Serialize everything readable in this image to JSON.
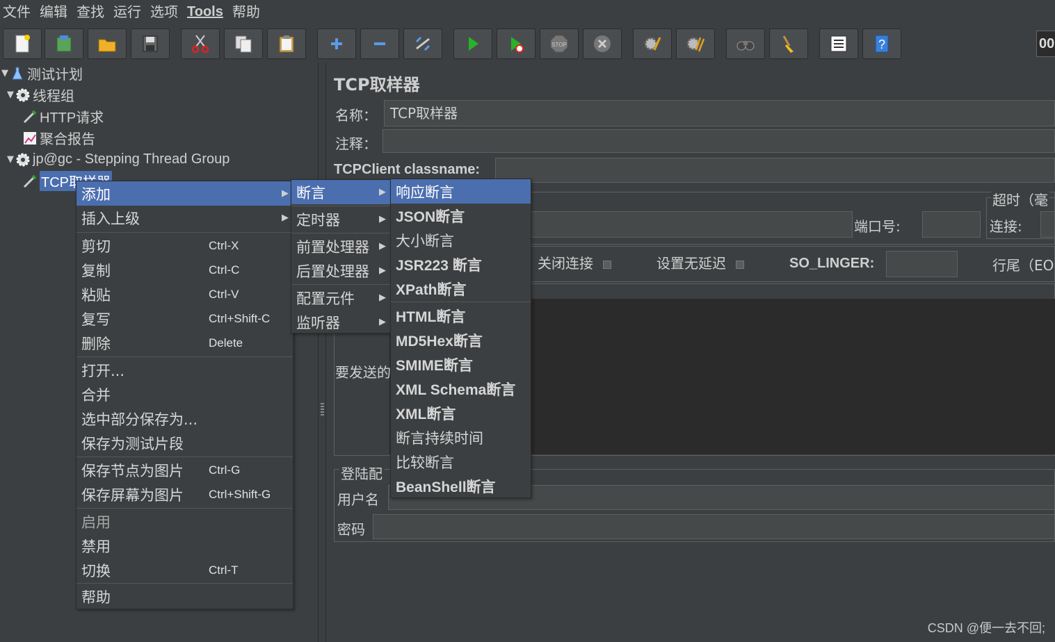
{
  "menubar": [
    "文件",
    "编辑",
    "查找",
    "运行",
    "选项",
    "Tools",
    "帮助"
  ],
  "toolbar": {
    "buttons": [
      "new-icon",
      "templates-icon",
      "open-icon",
      "save-icon",
      "cut-icon",
      "copy-icon",
      "paste-icon",
      "expand-icon",
      "collapse-icon",
      "toggle-icon",
      "start-icon",
      "start-no-pause-icon",
      "stop-icon",
      "shutdown-icon",
      "clear-icon",
      "clear-all-icon",
      "search-icon",
      "reset-search-icon",
      "function-helper-icon",
      "help-icon"
    ],
    "counter": "00"
  },
  "tree": {
    "nodes": [
      {
        "label": "测试计划"
      },
      {
        "label": "线程组"
      },
      {
        "label": "HTTP请求"
      },
      {
        "label": "聚合报告"
      },
      {
        "label": "jp@gc - Stepping Thread Group"
      },
      {
        "label": "TCP取样器"
      }
    ]
  },
  "panel": {
    "title": "TCP取样器",
    "name_label": "名称：",
    "name_value": "TCP取样器",
    "comment_label": "注释：",
    "classname_label": "TCPClient classname:",
    "timeout_label": "超时（毫",
    "port_label": "端口号:",
    "connect_label": "连接:",
    "close_conn_label": "关闭连接",
    "nodelay_label": "设置无延迟",
    "so_linger_label": "SO_LINGER:",
    "eol_label": "行尾（EO",
    "send_label": "要发送的",
    "login_group_label": "登陆配",
    "username_label": "用户名",
    "password_label": "密码"
  },
  "context_menu": {
    "items": [
      {
        "label": "添加",
        "submenu": true
      },
      {
        "label": "插入上级",
        "submenu": true
      },
      {
        "label": "剪切",
        "shortcut": "Ctrl-X"
      },
      {
        "label": "复制",
        "shortcut": "Ctrl-C"
      },
      {
        "label": "粘贴",
        "shortcut": "Ctrl-V"
      },
      {
        "label": "复写",
        "shortcut": "Ctrl+Shift-C"
      },
      {
        "label": "删除",
        "shortcut": "Delete"
      },
      {
        "label": "打开..."
      },
      {
        "label": "合并"
      },
      {
        "label": "选中部分保存为..."
      },
      {
        "label": "保存为测试片段"
      },
      {
        "label": "保存节点为图片",
        "shortcut": "Ctrl-G"
      },
      {
        "label": "保存屏幕为图片",
        "shortcut": "Ctrl+Shift-G"
      },
      {
        "label": "启用"
      },
      {
        "label": "禁用"
      },
      {
        "label": "切换",
        "shortcut": "Ctrl-T"
      },
      {
        "label": "帮助"
      }
    ]
  },
  "add_submenu": {
    "items": [
      "断言",
      "定时器",
      "前置处理器",
      "后置处理器",
      "配置元件",
      "监听器"
    ]
  },
  "assert_submenu": {
    "items": [
      "响应断言",
      "JSON断言",
      "大小断言",
      "JSR223 断言",
      "XPath断言",
      "HTML断言",
      "MD5Hex断言",
      "SMIME断言",
      "XML Schema断言",
      "XML断言",
      "断言持续时间",
      "比较断言",
      "BeanShell断言"
    ]
  },
  "watermark": "CSDN @便一去不回;",
  "colors": {
    "background": "#3c3f41",
    "selection": "#4b6eaf",
    "dark_field": "#2b2b2b"
  }
}
